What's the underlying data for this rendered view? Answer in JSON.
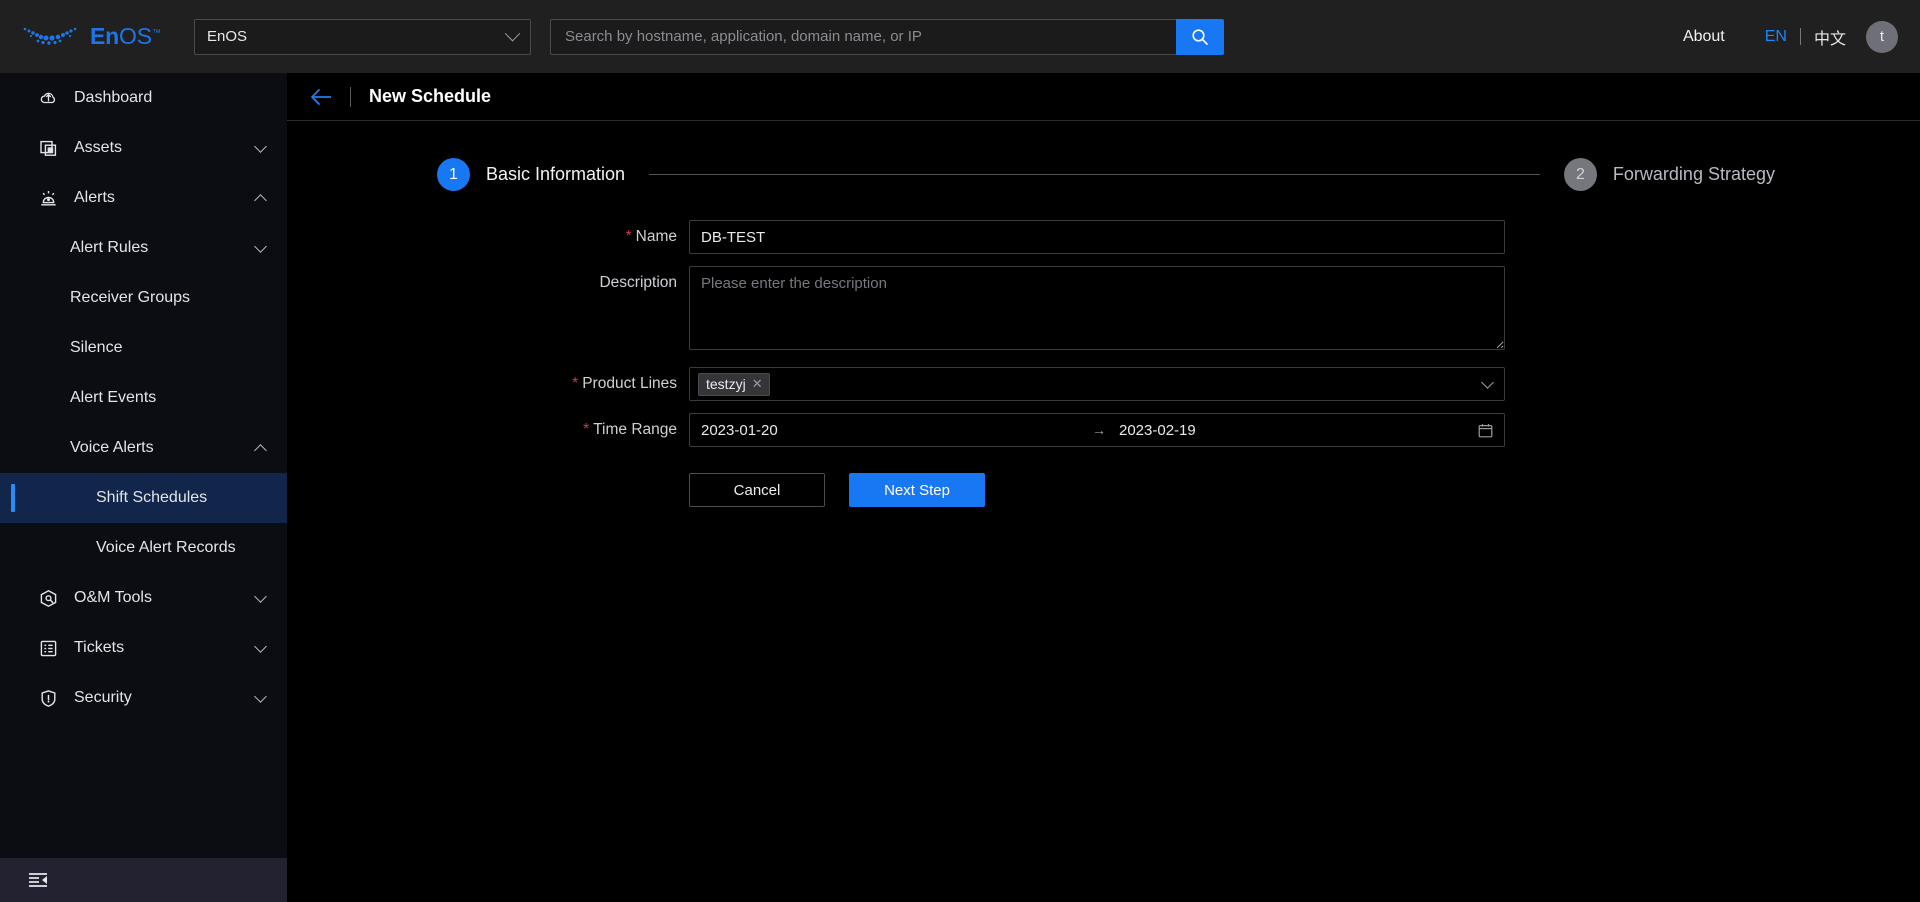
{
  "brand": {
    "name_bold": "En",
    "name_rest": "OS",
    "trademark": "™",
    "accent_color": "#1f74e8",
    "logo_icon": "enos-swoosh-logo"
  },
  "topbar": {
    "app_selector": {
      "value": "EnOS",
      "icon": "chevron-down-icon"
    },
    "search": {
      "placeholder": "Search by hostname, application, domain name, or IP",
      "value": "",
      "button_icon": "search-icon",
      "button_color": "#1877f2"
    },
    "about_label": "About",
    "lang_en": "EN",
    "lang_cn": "中文",
    "avatar_initial": "t"
  },
  "sidebar": {
    "items": [
      {
        "label": "Dashboard",
        "icon": "dashboard-cloud-icon",
        "level": 0,
        "expand": "none",
        "active": false
      },
      {
        "label": "Assets",
        "icon": "assets-icon",
        "level": 0,
        "expand": "collapsed",
        "active": false
      },
      {
        "label": "Alerts",
        "icon": "alert-bell-icon",
        "level": 0,
        "expand": "expanded",
        "active": false
      },
      {
        "label": "Alert Rules",
        "icon": "",
        "level": 1,
        "expand": "collapsed",
        "active": false
      },
      {
        "label": "Receiver Groups",
        "icon": "",
        "level": 1,
        "expand": "none",
        "active": false
      },
      {
        "label": "Silence",
        "icon": "",
        "level": 1,
        "expand": "none",
        "active": false
      },
      {
        "label": "Alert Events",
        "icon": "",
        "level": 1,
        "expand": "none",
        "active": false
      },
      {
        "label": "Voice Alerts",
        "icon": "",
        "level": 1,
        "expand": "expanded",
        "active": false
      },
      {
        "label": "Shift Schedules",
        "icon": "",
        "level": 2,
        "expand": "none",
        "active": true
      },
      {
        "label": "Voice Alert Records",
        "icon": "",
        "level": 2,
        "expand": "none",
        "active": false
      },
      {
        "label": "O&M Tools",
        "icon": "om-tools-icon",
        "level": 0,
        "expand": "collapsed",
        "active": false
      },
      {
        "label": "Tickets",
        "icon": "tickets-icon",
        "level": 0,
        "expand": "collapsed",
        "active": false
      },
      {
        "label": "Security",
        "icon": "shield-icon",
        "level": 0,
        "expand": "collapsed",
        "active": false
      }
    ],
    "collapse_icon": "collapse-sidebar-icon",
    "active_bg": "#11264a",
    "active_bar": "#2a8cf5"
  },
  "page": {
    "back_icon": "back-arrow-icon",
    "title": "New Schedule"
  },
  "stepper": {
    "steps": [
      {
        "number": "1",
        "label": "Basic Information",
        "state": "current"
      },
      {
        "number": "2",
        "label": "Forwarding Strategy",
        "state": "upcoming"
      }
    ]
  },
  "form": {
    "name": {
      "label": "Name",
      "required": true,
      "value": "DB-TEST",
      "placeholder": ""
    },
    "description": {
      "label": "Description",
      "required": false,
      "value": "",
      "placeholder": "Please enter the description"
    },
    "product_lines": {
      "label": "Product Lines",
      "required": true,
      "tags": [
        {
          "label": "testzyj",
          "remove_icon": "close-icon"
        }
      ],
      "dropdown_icon": "chevron-down-icon"
    },
    "time_range": {
      "label": "Time Range",
      "required": true,
      "start": "2023-01-20",
      "separator": "→",
      "end": "2023-02-19",
      "calendar_icon": "calendar-icon"
    },
    "buttons": {
      "cancel": "Cancel",
      "next": "Next Step"
    }
  }
}
